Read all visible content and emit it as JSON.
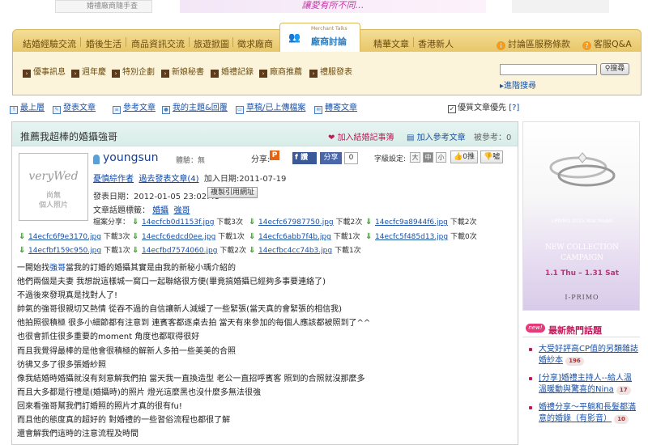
{
  "top": {
    "logo_text": "婚禮廠商隨手查",
    "banner_text": "讓愛有所不同…"
  },
  "nav": {
    "tabs": [
      "結婚經驗交流",
      "婚後生活",
      "商品資訊交流",
      "旅遊掀圖",
      "徵求廠商"
    ],
    "active_sub": "Merchant Talks",
    "active_label": "廠商討論",
    "more_tabs": [
      "精華文章",
      "香港新人"
    ],
    "forum_rules": "討論區服務條款",
    "customer_qa": "客服Q&A"
  },
  "subnav": {
    "items": [
      "優事訊息",
      "週年慶",
      "特別企劃",
      "新娘秘書",
      "婚禮記錄",
      "廠商推薦",
      "禮服發表"
    ],
    "search_button": "搜尋",
    "advanced_search": "進階搜尋"
  },
  "toolbar": {
    "links": [
      "最上層",
      "發表文章",
      "參考文章",
      "我的主題&回覆",
      "草稿/已上傳檔案",
      "轉寄文章"
    ],
    "priority": "優質文章優先",
    "help": "[?]"
  },
  "post": {
    "title": "推薦我超棒的婚攝強哥",
    "add_exp": "加入結婚記事簿",
    "add_ref": "加入參考文章",
    "ref_count": "被參考：0",
    "avatar_brand": "veryWed",
    "avatar_na1": "尚無",
    "avatar_na2": "個人照片",
    "username": "youngsun",
    "rank": "體驗：無",
    "share_label": "分享:",
    "fb_label": "讚",
    "share_btn": "分享",
    "share_count": "0",
    "font_label": "字級設定:",
    "font_sizes": [
      "大",
      "中",
      "小"
    ],
    "like_btn": "0推",
    "bad_btn": "噓",
    "profile_link": "憂慎綜作者",
    "past_posts": "過去發表文章(4)",
    "join_date": "加入日期:2011-07-19",
    "post_date": "發表日期：2012-01-05 23:02:43",
    "copy_btn": "複製引用網址",
    "tags_label": "文章話題標籤：",
    "tags": [
      "婚攝",
      "強哥"
    ],
    "files_label": "檔案分享：",
    "attachments": [
      {
        "name": "14ecfcb0d1153f.jpg",
        "dl": "下載3次"
      },
      {
        "name": "14ecfc67987750.jpg",
        "dl": "下載2次"
      },
      {
        "name": "14ecfc9a8944f6.jpg",
        "dl": "下載2次"
      },
      {
        "name": "14ecfc6f9e3170.jpg",
        "dl": "下載3次"
      },
      {
        "name": "14ecfc6edcd0ee.jpg",
        "dl": "下載1次"
      },
      {
        "name": "14ecfc6abb7f4b.jpg",
        "dl": "下載1次"
      },
      {
        "name": "14ecfc5f485d13.jpg",
        "dl": "下載0次"
      },
      {
        "name": "14ecfbf159c950.jpg",
        "dl": "下載1次"
      },
      {
        "name": "14ecfbd7574060.jpg",
        "dl": "下載2次"
      },
      {
        "name": "14ecfbc4cc74b3.jpg",
        "dl": "下載1次"
      }
    ],
    "body_line0_a": "一開始找",
    "body_line0_link": "強哥",
    "body_line0_b": "當我的訂婚的婚攝其實是由我的新秘小瑀介紹的",
    "body": [
      "他們兩個是夫妻 我想說這樣城一窩口一起聯絡很方便(畢竟搞婚攝已經夠多事要連絡了)",
      "不過後來發現真是找對人了!",
      "帥氣的強哥很親切又熱情 從吞不過的自信讓新人減緩了一些緊張(當天真的會緊張的相信我)",
      "他拍照很積極 很多小細節都有注意到 連賓客都逐桌去拍 當天有來參加的每個人應該都被照到了^^",
      "也很會抓住很多重要的moment 角度也都取得很好",
      "而且我覺得最棒的是他會很積極的解新人多拍一些美美的合照",
      "彷彿又多了很多張婚紗照",
      "像我結婚時婚攝就沒有刻意解我們拍 當天我一直換造型 老公一直招呼賓客 照到的合照就沒那麼多",
      "而且大多都是行禮是(婚攝時)的照片 燈光這麼黑也沒什麼多無法很強",
      "回來看強哥幫我們訂婚照的照片才真的很有fu!",
      "而且他的態度真的超好的 對婚禮的一些習俗流程也都很了解",
      "還會解我們這時的注意流程及時間"
    ]
  },
  "sidebar": {
    "ad": {
      "year_model": "I-PRIMO 2015 Year Model",
      "line1": "NEW COLLECTION",
      "line2": "CAMPAIGN",
      "date": "1.1 Thu – 1.31 Sat",
      "brand": "I-PRIMO"
    },
    "hot_badge": "new!",
    "hot_title": "最新熱門話題",
    "hot": [
      {
        "title": "大受好評高CP值的另類雜誌婚紗本",
        "count": "196"
      },
      {
        "title": "[分享]婚禮主持人--給人溫溫暖動與驚喜的Nina",
        "count": "17"
      },
      {
        "title": "婚禮分享～平躺和長髮都滿意的婚錄（有影音）",
        "count": "10"
      }
    ]
  }
}
